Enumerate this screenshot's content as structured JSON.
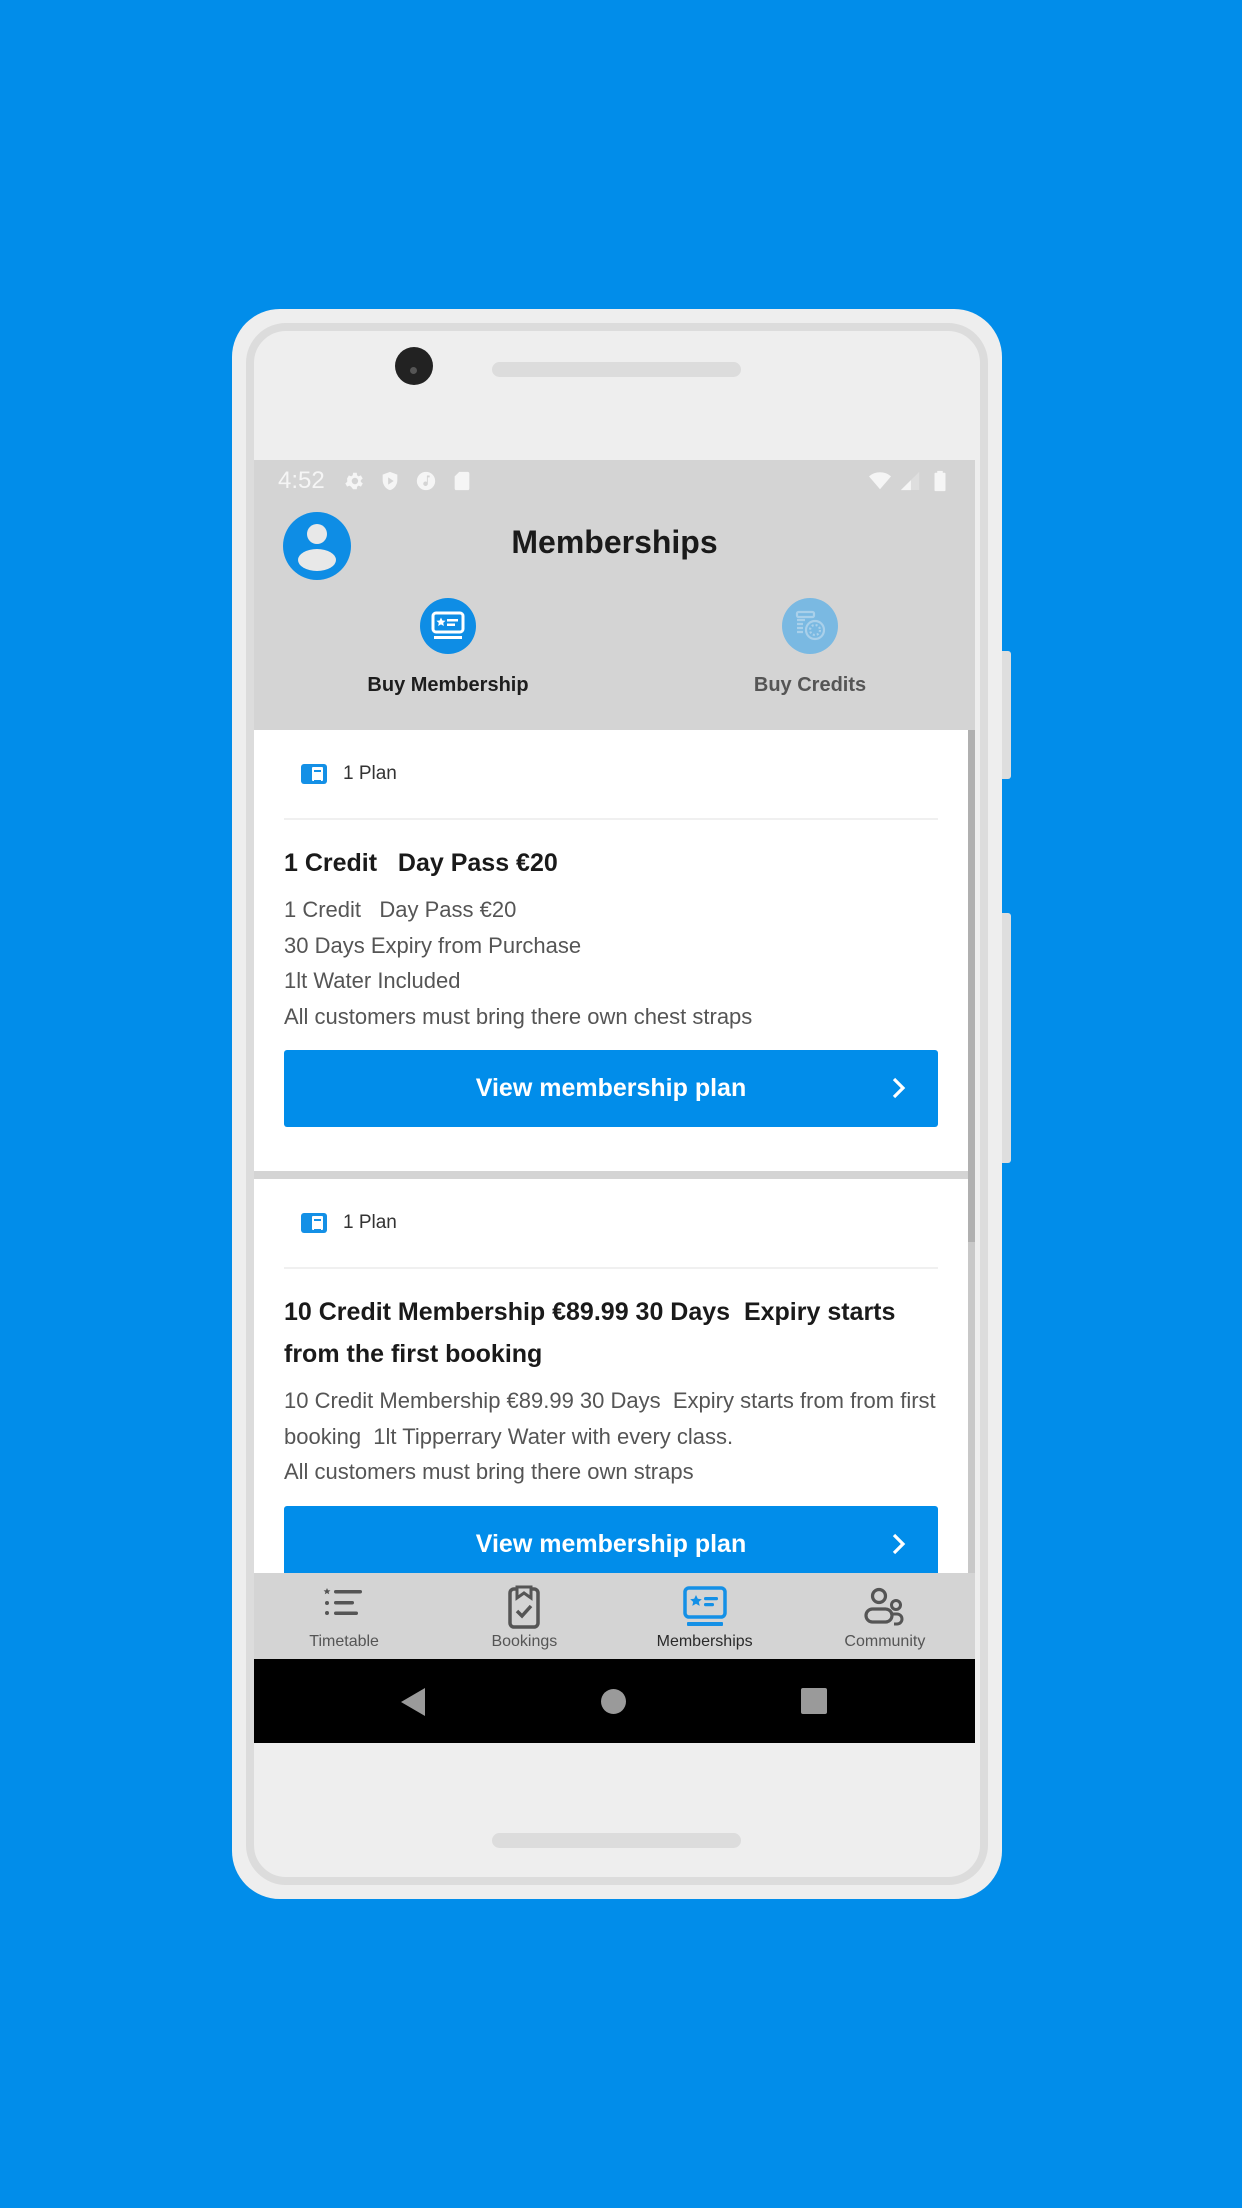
{
  "status_bar": {
    "time": "4:52",
    "left_icons": [
      "settings-icon",
      "shield-play-icon",
      "music-icon",
      "sd-card-icon"
    ],
    "right_icons": [
      "wifi-icon",
      "signal-icon",
      "battery-icon"
    ]
  },
  "header": {
    "title": "Memberships",
    "avatar_icon": "user-icon"
  },
  "top_nav": {
    "items": [
      {
        "label": "Buy Membership",
        "icon": "membership-card-icon",
        "active": true
      },
      {
        "label": "Buy Credits",
        "icon": "credits-coins-icon",
        "active": false
      }
    ]
  },
  "plans": [
    {
      "count_label": "1 Plan",
      "title": "1 Credit   Day Pass €20",
      "description": [
        "1 Credit   Day Pass €20",
        "30 Days Expiry from Purchase",
        "1lt Water Included",
        "All customers must bring there own chest straps"
      ],
      "button_label": "View membership plan"
    },
    {
      "count_label": "1 Plan",
      "title": "10 Credit Membership €89.99 30 Days  Expiry starts  from the first booking",
      "description": [
        "10 Credit Membership €89.99 30 Days  Expiry starts from from first booking  1lt Tipperrary Water with every class.",
        "All customers must bring there own straps"
      ],
      "button_label": "View membership plan"
    }
  ],
  "bottom_nav": {
    "items": [
      {
        "label": "Timetable",
        "icon": "timetable-list-icon",
        "active": false
      },
      {
        "label": "Bookings",
        "icon": "clipboard-check-icon",
        "active": false
      },
      {
        "label": "Memberships",
        "icon": "membership-card-icon",
        "active": true
      },
      {
        "label": "Community",
        "icon": "community-people-icon",
        "active": false
      }
    ]
  },
  "system_nav": [
    "back-icon",
    "home-icon",
    "recents-icon"
  ],
  "colors": {
    "background": "#018dea",
    "accent": "#018dea",
    "inactive_accent": "#7ab9e2",
    "app_bar": "#d4d4d4",
    "card": "#ffffff",
    "icon_gray": "#555555"
  }
}
